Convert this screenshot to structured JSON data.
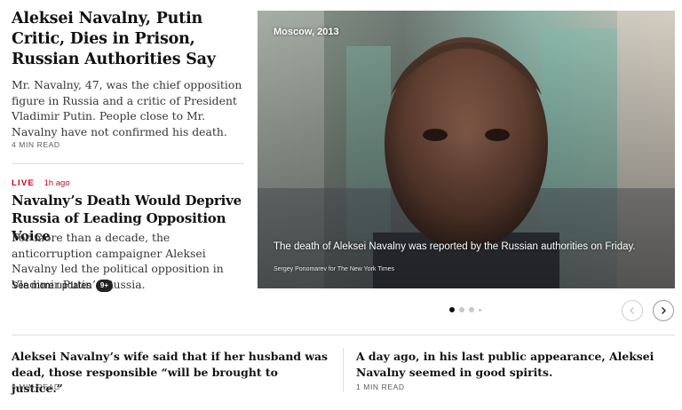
{
  "lead_story": {
    "headline": "Aleksei Navalny, Putin Critic, Dies in Prison, Russian Authorities Say",
    "summary": "Mr. Navalny, 47, was the chief opposition figure in Russia and a critic of President Vladimir Putin. People close to Mr. Navalny have not confirmed his death.",
    "read_time": "4 MIN READ"
  },
  "live_story": {
    "live_label": "LIVE",
    "time_ago": "1h ago",
    "headline": "Navalny’s Death Would Deprive Russia of Leading Opposition Voice",
    "summary": "For more than a decade, the anticorruption campaigner Aleksei Navalny led the political opposition in Vladimir Putin’s Russia.",
    "updates_label": "See more updates",
    "updates_badge": "9+"
  },
  "photo": {
    "location": "Moscow, 2013",
    "caption": "The death of Aleksei Navalny was reported by the Russian authorities on Friday.",
    "credit": "Sergey Ponomarev for The New York Times"
  },
  "carousel": {
    "prev_icon": "chevron-left-icon",
    "next_icon": "chevron-right-icon",
    "active_index": 0,
    "dot_count": 4
  },
  "bottom_stories": [
    {
      "headline": "Aleksei Navalny’s wife said that if her husband was dead, those responsible “will be brought to justice.”",
      "read_time": "3 MIN READ"
    },
    {
      "headline": "A day ago, in his last public appearance, Aleksei Navalny seemed in good spirits.",
      "read_time": "1 MIN READ"
    }
  ],
  "colors": {
    "live_red": "#d0021b",
    "text": "#121212"
  }
}
